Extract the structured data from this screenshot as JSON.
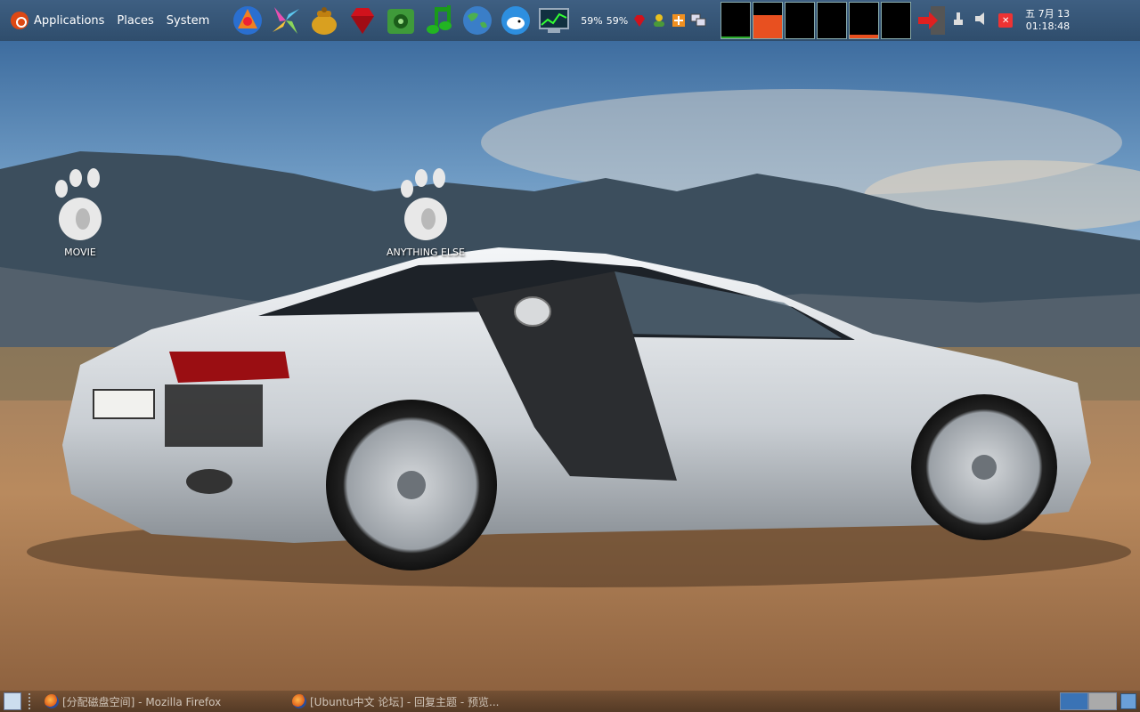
{
  "menu": {
    "applications": "Applications",
    "places": "Places",
    "system": "System"
  },
  "launchers": [
    {
      "icon": "dragon-app-icon"
    },
    {
      "icon": "pinwheel-app-icon"
    },
    {
      "icon": "honey-pot-icon"
    },
    {
      "icon": "ruby-gem-icon"
    },
    {
      "icon": "media-player-icon"
    },
    {
      "icon": "music-note-icon"
    },
    {
      "icon": "globe-browser-icon"
    },
    {
      "icon": "whale-chat-icon"
    },
    {
      "icon": "system-monitor-icon"
    }
  ],
  "tray": {
    "cpu_label_1": "59%",
    "cpu_label_2": "59%",
    "icons": [
      "ruby-tray-icon",
      "user-status-icon",
      "update-notify-icon",
      "network-icon"
    ]
  },
  "system_monitors": [
    {
      "name": "cpu-monitor",
      "level": 0.05,
      "color": "#2aa82a"
    },
    {
      "name": "memory-monitor",
      "level": 0.65,
      "color": "#e85020"
    },
    {
      "name": "network-monitor",
      "level": 0.0,
      "color": "#2aa8ff"
    },
    {
      "name": "swap-monitor",
      "level": 0.0,
      "color": "#9050d0"
    },
    {
      "name": "load-monitor",
      "level": 0.1,
      "color": "#e85020"
    },
    {
      "name": "disk-monitor",
      "level": 0.0,
      "color": "#ff7020"
    }
  ],
  "clock": {
    "date": "五 7月 13",
    "time": "01:18:48"
  },
  "desktop_icons": [
    {
      "label": "MOVIE"
    },
    {
      "label": "ANYTHING ELSE"
    }
  ],
  "taskbar": {
    "windows": [
      {
        "title": "[分配磁盘空间] - Mozilla Firefox"
      },
      {
        "title": "[Ubuntu中文 论坛] - 回复主题 - 预览..."
      }
    ]
  },
  "colors": {
    "panel": "#3e5f82",
    "accent_red": "#dd4814"
  }
}
